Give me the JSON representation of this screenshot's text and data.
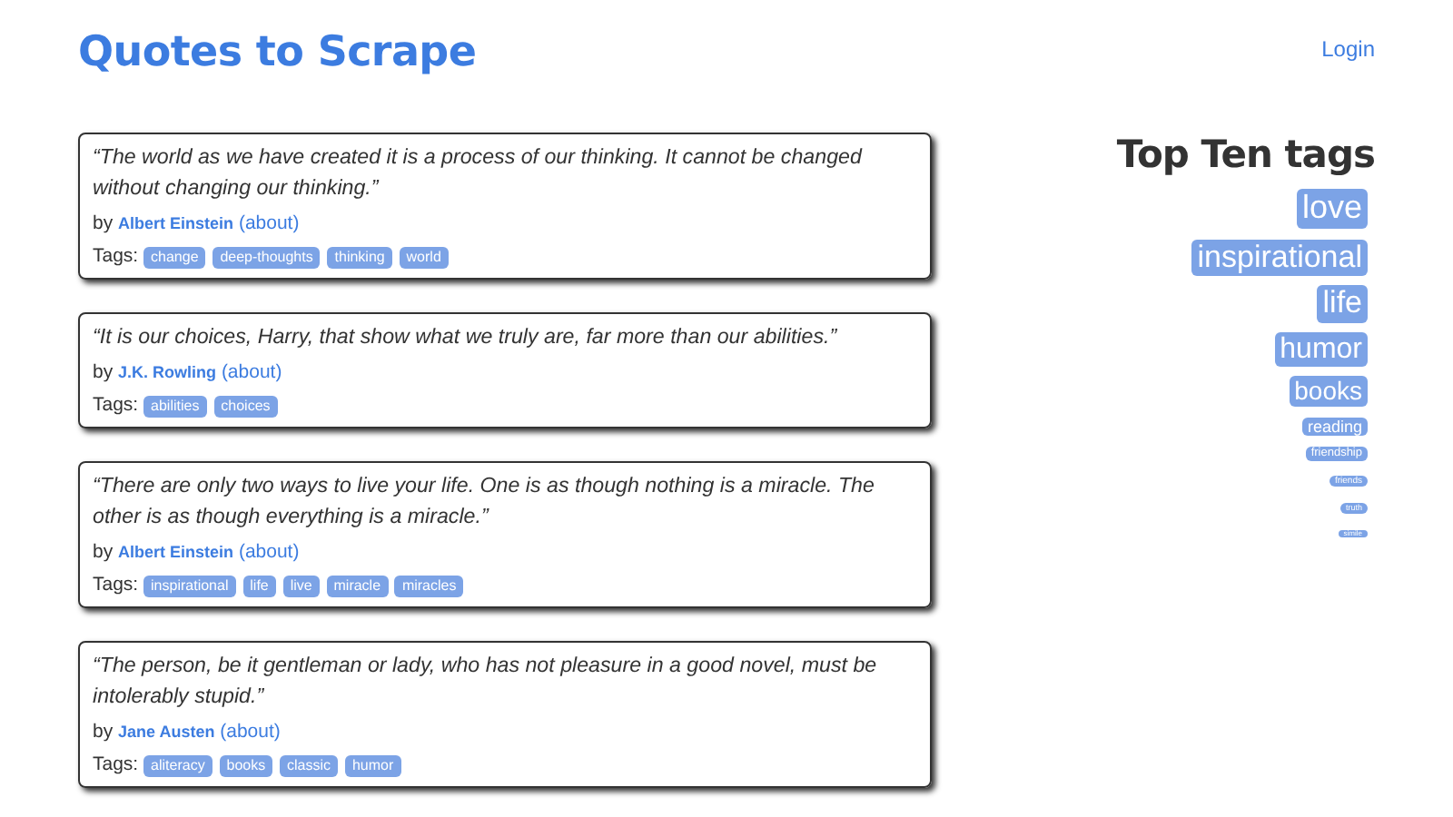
{
  "header": {
    "title": "Quotes to Scrape",
    "login": "Login"
  },
  "quotes": [
    {
      "text": "“The world as we have created it is a process of our thinking. It cannot be changed without changing our thinking.”",
      "by": "by",
      "author": "Albert Einstein",
      "about": "(about)",
      "tags_label": "Tags:",
      "tags": [
        "change",
        "deep-thoughts",
        "thinking",
        "world"
      ]
    },
    {
      "text": "“It is our choices, Harry, that show what we truly are, far more than our abilities.”",
      "by": "by",
      "author": "J.K. Rowling",
      "about": "(about)",
      "tags_label": "Tags:",
      "tags": [
        "abilities",
        "choices"
      ]
    },
    {
      "text": "“There are only two ways to live your life. One is as though nothing is a miracle. The other is as though everything is a miracle.”",
      "by": "by",
      "author": "Albert Einstein",
      "about": "(about)",
      "tags_label": "Tags:",
      "tags": [
        "inspirational",
        "life",
        "live",
        "miracle",
        "miracles"
      ]
    },
    {
      "text": "“The person, be it gentleman or lady, who has not pleasure in a good novel, must be intolerably stupid.”",
      "by": "by",
      "author": "Jane Austen",
      "about": "(about)",
      "tags_label": "Tags:",
      "tags": [
        "aliteracy",
        "books",
        "classic",
        "humor"
      ]
    }
  ],
  "top_tags": {
    "title": "Top Ten tags",
    "tags": [
      "love",
      "inspirational",
      "life",
      "humor",
      "books",
      "reading",
      "friendship",
      "friends",
      "truth",
      "simile"
    ]
  }
}
